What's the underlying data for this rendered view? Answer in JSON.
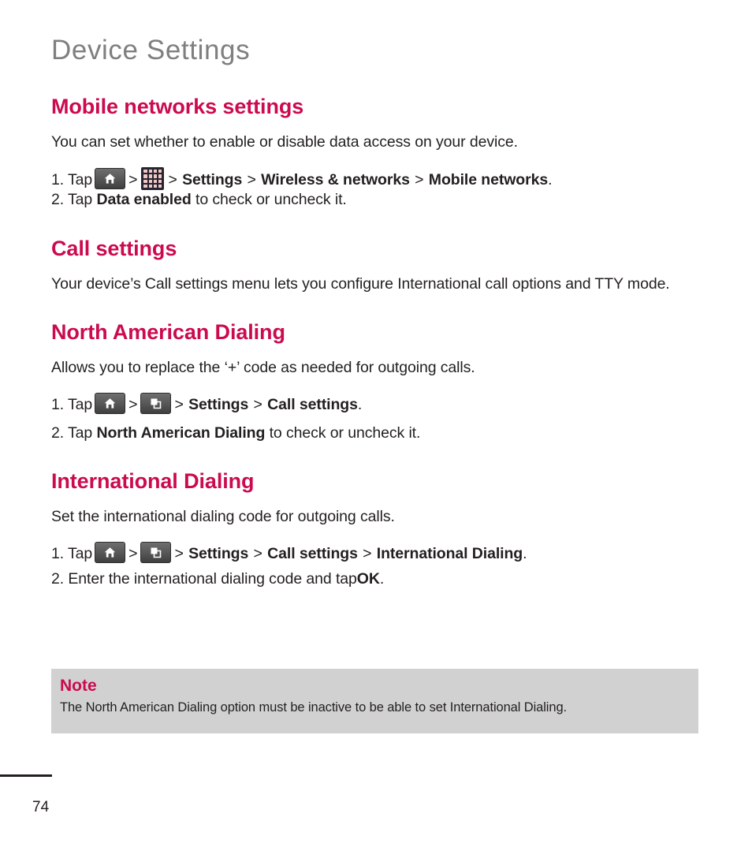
{
  "document": {
    "running_head": "Device Settings",
    "page_number": "74",
    "accent_color": "#cc0a4e",
    "head_color": "#807f80",
    "body_color": "#231f20",
    "note_bg": "#d1d1d1"
  },
  "sections": [
    {
      "heading": "Mobile networks settings",
      "intro": "You can set whether to enable or disable data access on your device.",
      "steps": [
        {
          "number": "1. Tap",
          "icons": [
            "home-key-icon",
            "apps-grid-icon"
          ],
          "sep1": ">",
          "sep2": ">",
          "sep3": ">",
          "sep4": ">",
          "crumb1": "Settings",
          "crumb2": "Wireless & networks",
          "crumb3": "Mobile networks",
          "tail": "."
        },
        {
          "prefix": "2. Tap",
          "bold": "Data enabled",
          "suffix": "to check or uncheck it."
        }
      ]
    },
    {
      "heading": "Call settings",
      "intro": "Your device’s Call settings menu lets you configure International call options and TTY mode."
    },
    {
      "heading": "North American Dialing",
      "intro": "Allows you to replace the ‘+’ code as needed for outgoing calls.",
      "steps": [
        {
          "number": "1. Tap",
          "icons": [
            "home-key-icon",
            "menu-key-icon"
          ],
          "sep1": ">",
          "sep2": ">",
          "sep3": ">",
          "crumb1": "Settings",
          "crumb2": "Call settings",
          "tail": "."
        },
        {
          "prefix": "2. Tap",
          "bold": "North American Dialing",
          "suffix": "to check or uncheck it."
        }
      ]
    },
    {
      "heading": "International Dialing",
      "intro": "Set the international dialing code for outgoing calls.",
      "steps": [
        {
          "number": "1. Tap",
          "icons": [
            "home-key-icon",
            "menu-key-icon"
          ],
          "sep1": ">",
          "sep2": ">",
          "sep3": ">",
          "sep4": ">",
          "crumb1": "Settings",
          "crumb2": "Call settings",
          "crumb3": "International Dialing",
          "tail": "."
        },
        {
          "prefix": "2. Enter the international dialing code and tap",
          "bold": "OK",
          "suffix": "."
        }
      ]
    }
  ],
  "note": {
    "title": "Note",
    "text": "The North American Dialing option must be inactive to be able to set International Dialing."
  }
}
